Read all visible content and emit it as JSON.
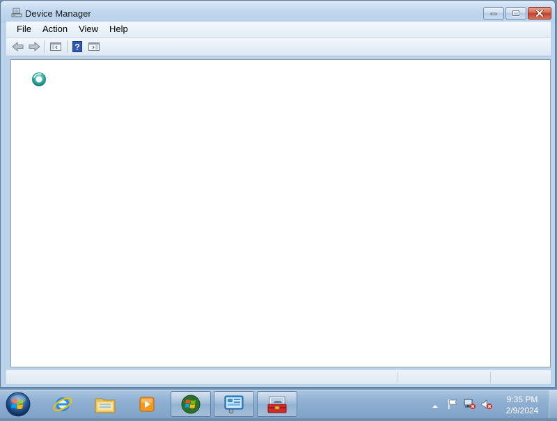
{
  "window": {
    "title": "Device Manager",
    "icon": "device-manager-icon"
  },
  "menu": [
    {
      "label": "File"
    },
    {
      "label": "Action"
    },
    {
      "label": "View"
    },
    {
      "label": "Help"
    }
  ],
  "toolbar": {
    "buttons": [
      "back-arrow-icon",
      "forward-arrow-icon",
      "show-hide-console-tree-icon",
      "help-icon",
      "show-hide-action-pane-icon"
    ]
  },
  "content": {
    "state": "loading",
    "indicator": "busy-spinner-icon"
  },
  "taskbar": {
    "pinned": [
      "start-orb-icon",
      "internet-explorer-icon",
      "windows-explorer-icon",
      "windows-media-player-icon",
      "windows-logo-icon",
      "control-panel-icon",
      "device-manager-toolbox-icon"
    ],
    "clock": {
      "time": "9:35 PM",
      "date": "2/9/2024"
    },
    "tray": [
      "action-center-flag-icon",
      "network-icon",
      "volume-muted-icon"
    ]
  },
  "colors": {
    "close_button": "#c0412b",
    "taskbar": "#8fb0d2",
    "content_background": "#ffffff"
  }
}
